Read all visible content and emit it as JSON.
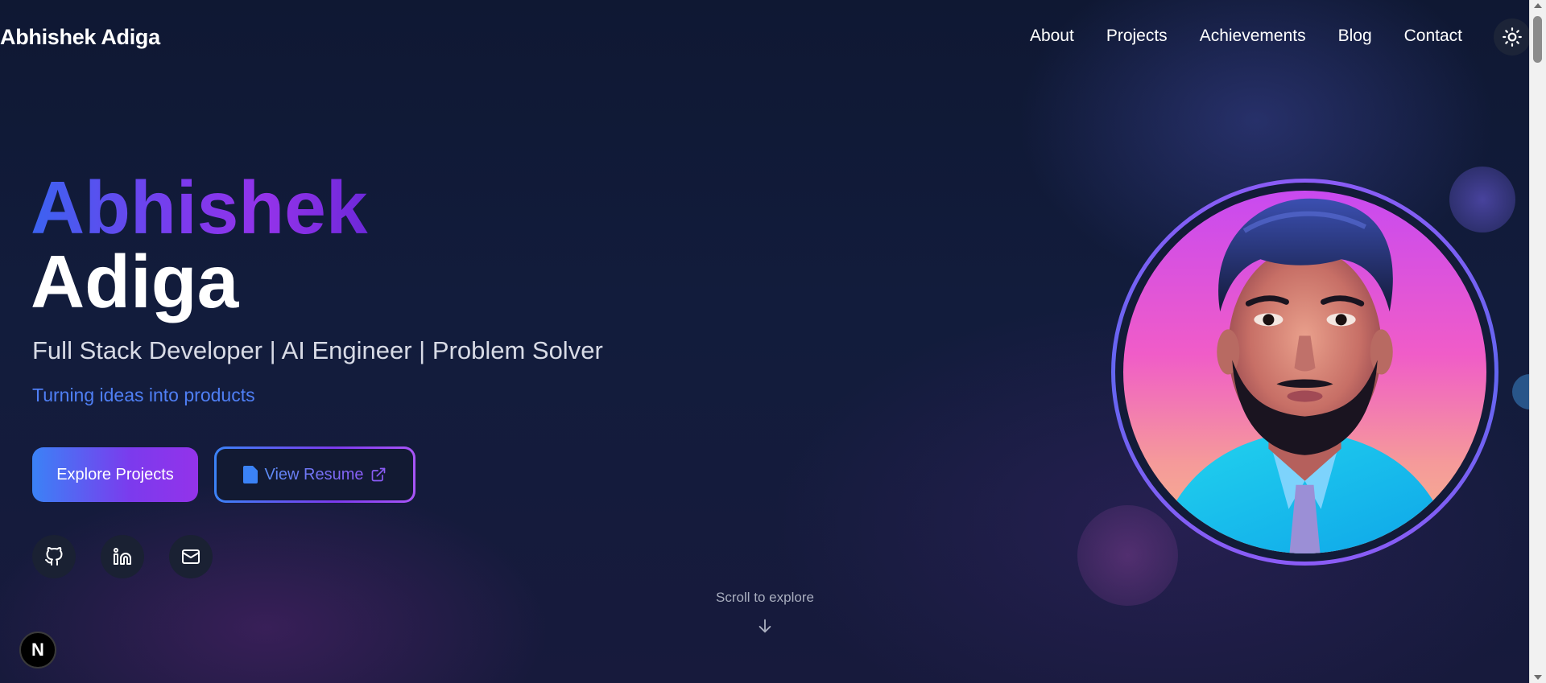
{
  "brand": "Abhishek Adiga",
  "nav": {
    "links": [
      "About",
      "Projects",
      "Achievements",
      "Blog",
      "Contact"
    ],
    "theme_toggle_icon": "sun-icon"
  },
  "hero": {
    "first_name": "Abhishek",
    "last_name": "Adiga",
    "roles": "Full Stack Developer | AI Engineer | Problem Solver",
    "tagline": "Turning ideas into products",
    "primary_button": "Explore Projects",
    "secondary_button": "View Resume",
    "secondary_button_icons": [
      "document-icon",
      "external-link-icon"
    ],
    "socials": [
      "github-icon",
      "linkedin-icon",
      "mail-icon"
    ]
  },
  "scroll_hint": {
    "text": "Scroll to explore",
    "icon": "arrow-down-icon"
  },
  "dev_badge": "N",
  "colors": {
    "background": "#101a36",
    "accent_blue": "#3b82f6",
    "accent_purple": "#9333ea",
    "tagline": "#4f7ff5"
  }
}
